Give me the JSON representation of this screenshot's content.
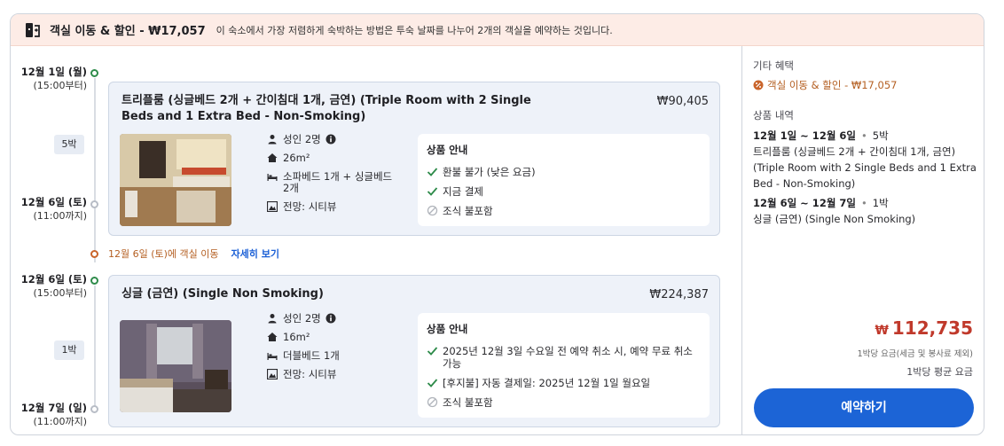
{
  "banner": {
    "title": "객실 이동 & 할인 - ₩17,057",
    "description": "이 숙소에서 가장 저렴하게 숙박하는 방법은 투숙 날짜를 나누어 2개의 객실을 예약하는 것입니다."
  },
  "timeline": {
    "stay1": {
      "checkin_date": "12월 1일 (월)",
      "checkin_time": "(15:00부터)",
      "nights": "5박",
      "checkout_date": "12월 6일 (토)",
      "checkout_time": "(11:00까지)"
    },
    "move": {
      "text": "12월 6일 (토)에 객실 이동",
      "link": "자세히 보기"
    },
    "stay2": {
      "checkin_date": "12월 6일 (토)",
      "checkin_time": "(15:00부터)",
      "nights": "1박",
      "checkout_date": "12월 7일 (일)",
      "checkout_time": "(11:00까지)"
    }
  },
  "rooms": [
    {
      "title": "트리플룸 (싱글베드 2개 + 간이침대 1개, 금연) (Triple Room with 2 Single Beds and 1 Extra Bed - Non-Smoking)",
      "price": "₩90,405",
      "features": {
        "guests": "성인 2명",
        "size": "26m²",
        "beds": "소파베드 1개 + 싱글베드 2개",
        "view": "전망: 시티뷰"
      },
      "product_info": {
        "heading": "상품 안내",
        "items": [
          {
            "text": "환불 불가 (낮은 요금)",
            "icon": "check-icon"
          },
          {
            "text": "지금 결제",
            "icon": "check-icon"
          },
          {
            "text": "조식 불포함",
            "icon": "no-icon"
          }
        ]
      }
    },
    {
      "title": "싱글 (금연) (Single Non Smoking)",
      "price": "₩224,387",
      "features": {
        "guests": "성인 2명",
        "size": "16m²",
        "beds": "더블베드 1개",
        "view": "전망: 시티뷰"
      },
      "product_info": {
        "heading": "상품 안내",
        "items": [
          {
            "text": "2025년 12월 3일 수요일 전 예약 취소 시, 예약 무료 취소 가능",
            "icon": "check-icon"
          },
          {
            "text": "[후지불] 자동 결제일: 2025년 12월 1일 월요일",
            "icon": "check-icon"
          },
          {
            "text": "조식 불포함",
            "icon": "no-icon"
          }
        ]
      }
    }
  ],
  "summary": {
    "benefits_heading": "기타 혜택",
    "benefit": "객실 이동 & 할인 - ₩17,057",
    "details_heading": "상품 내역",
    "stay1_dates": "12월 1일 ~ 12월 6일",
    "stay1_nights": "5박",
    "stay1_room": "트리플룸 (싱글베드 2개 + 간이침대 1개, 금연) (Triple Room with 2 Single Beds and 1 Extra Bed - Non-Smoking)",
    "stay2_dates": "12월 6일 ~ 12월 7일",
    "stay2_nights": "1박",
    "stay2_room": "싱글 (금연) (Single Non Smoking)",
    "currency": "₩",
    "total": "112,735",
    "note1": "1박당 요금(세금 및 봉사료 제외)",
    "note2": "1박당 평균 요금",
    "book_button": "예약하기"
  },
  "colors": {
    "accent": "#1c64d6",
    "price": "#c0392b",
    "move": "#b45f22",
    "check": "#2e8b4a"
  }
}
